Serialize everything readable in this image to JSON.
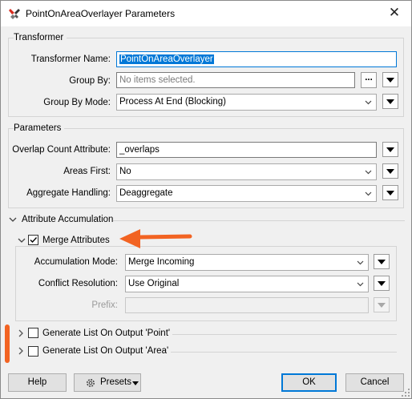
{
  "window": {
    "title": "PointOnAreaOverlayer Parameters",
    "icon": "fme-transformer-icon",
    "close_label": "✕"
  },
  "transformer": {
    "section_title": "Transformer",
    "name_label": "Transformer Name:",
    "name_value": "PointOnAreaOverlayer",
    "group_by_label": "Group By:",
    "group_by_placeholder": "No items selected.",
    "group_by_button": "...",
    "group_by_mode_label": "Group By Mode:",
    "group_by_mode_value": "Process At End (Blocking)"
  },
  "parameters": {
    "section_title": "Parameters",
    "overlap_label": "Overlap Count Attribute:",
    "overlap_value": "_overlaps",
    "areas_first_label": "Areas First:",
    "areas_first_value": "No",
    "aggregate_label": "Aggregate Handling:",
    "aggregate_value": "Deaggregate"
  },
  "accumulation": {
    "section_title": "Attribute Accumulation",
    "merge_label": "Merge Attributes",
    "merge_checked": true,
    "mode_label": "Accumulation Mode:",
    "mode_value": "Merge Incoming",
    "conflict_label": "Conflict Resolution:",
    "conflict_value": "Use Original",
    "prefix_label": "Prefix:",
    "prefix_value": ""
  },
  "lists": [
    {
      "label": "Generate List On Output 'Point'",
      "checked": false
    },
    {
      "label": "Generate List On Output 'Area'",
      "checked": false
    }
  ],
  "footer": {
    "help": "Help",
    "presets": "Presets",
    "ok": "OK",
    "cancel": "Cancel"
  },
  "annotation": {
    "arrow_color": "#f26322",
    "bar_color": "#f26322"
  }
}
